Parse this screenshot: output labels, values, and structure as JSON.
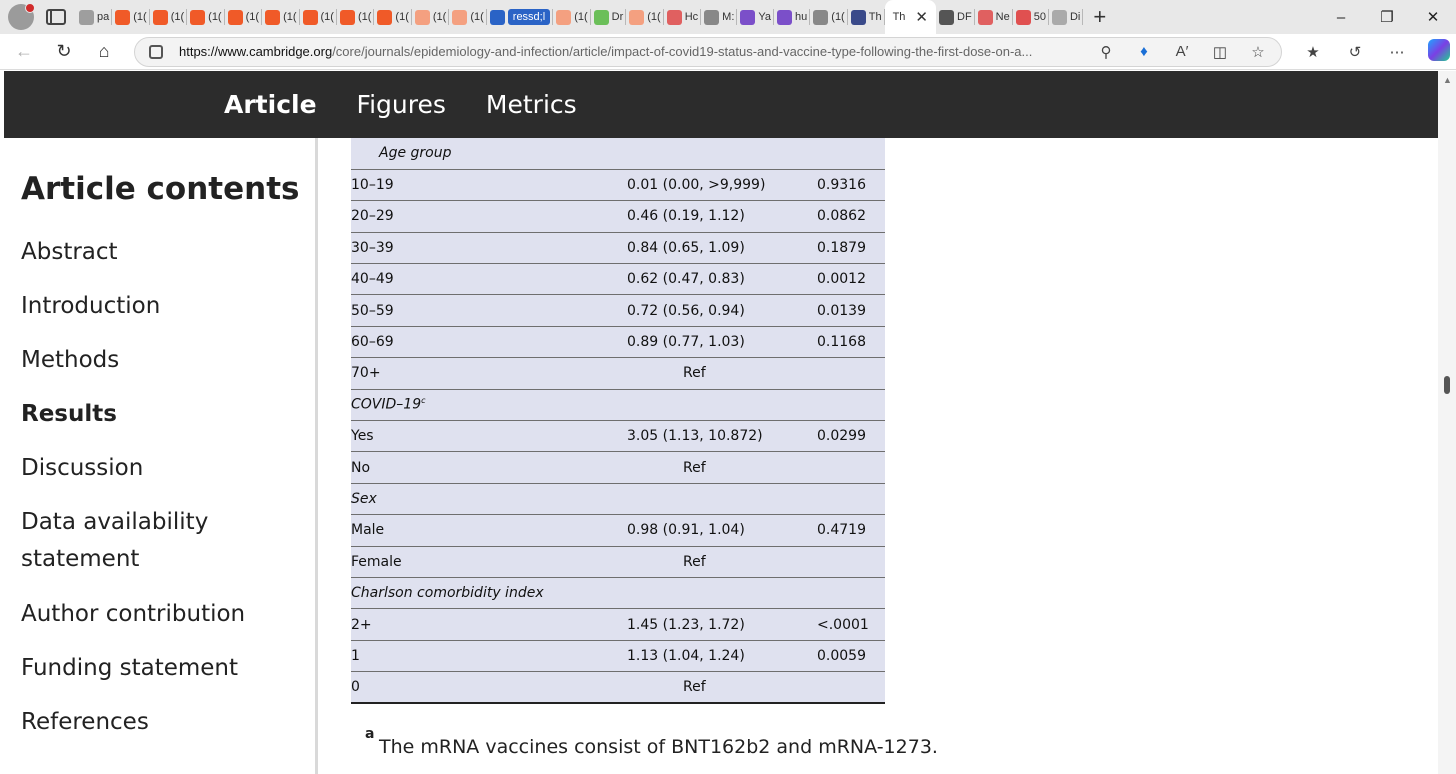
{
  "browser": {
    "tabs": [
      {
        "label": "pa",
        "color": "#9e9e9e"
      },
      {
        "label": "(1(",
        "color": "#f05a28"
      },
      {
        "label": "(1(",
        "color": "#f05a28"
      },
      {
        "label": "(1(",
        "color": "#f05a28"
      },
      {
        "label": "(1(",
        "color": "#f05a28"
      },
      {
        "label": "(1(",
        "color": "#f05a28"
      },
      {
        "label": "(1(",
        "color": "#f05a28"
      },
      {
        "label": "(1(",
        "color": "#f05a28"
      },
      {
        "label": "(1(",
        "color": "#f05a28"
      },
      {
        "label": "(1(",
        "color": "#f4a080"
      },
      {
        "label": "(1(",
        "color": "#f4a080"
      },
      {
        "label": "ressd;l",
        "color": "#2a63c6",
        "pill": true
      },
      {
        "label": "(1(",
        "color": "#f4a080"
      },
      {
        "label": "Dr",
        "color": "#6bbf59"
      },
      {
        "label": "(1(",
        "color": "#f4a080"
      },
      {
        "label": "Hc",
        "color": "#e06060"
      },
      {
        "label": "M:",
        "color": "#888888"
      },
      {
        "label": "Ya",
        "color": "#7b4fc9"
      },
      {
        "label": "hu",
        "color": "#7b4fc9"
      },
      {
        "label": "(1(",
        "color": "#888888"
      },
      {
        "label": "Th",
        "color": "#3a4a8a"
      }
    ],
    "active_tab": "Th",
    "tabs_after": [
      {
        "label": "DF",
        "color": "#555555"
      },
      {
        "label": "Ne",
        "color": "#e06060"
      },
      {
        "label": "50",
        "color": "#e05050"
      },
      {
        "label": "Di",
        "color": "#aaaaaa"
      }
    ],
    "url_host": "https://www.cambridge.org",
    "url_rest": "/core/journals/epidemiology-and-infection/article/impact-of-covid19-status-and-vaccine-type-following-the-first-dose-on-a..."
  },
  "site_nav": {
    "items": [
      "Article",
      "Figures",
      "Metrics"
    ]
  },
  "sidebar": {
    "title": "Article contents",
    "items": [
      {
        "label": "Abstract",
        "bold": false
      },
      {
        "label": "Introduction",
        "bold": false
      },
      {
        "label": "Methods",
        "bold": false
      },
      {
        "label": "Results",
        "bold": true
      },
      {
        "label": "Discussion",
        "bold": false
      },
      {
        "label": "Data availability statement",
        "bold": false
      },
      {
        "label": "Author contribution",
        "bold": false
      },
      {
        "label": "Funding statement",
        "bold": false
      },
      {
        "label": "References",
        "bold": false
      }
    ]
  },
  "table": {
    "rows": [
      {
        "kind": "cat",
        "label": "Age group",
        "indent": true
      },
      {
        "kind": "row",
        "label": "10–19",
        "or": "0.01 (0.00, >9,999)",
        "p": "0.9316",
        "lvl": 1
      },
      {
        "kind": "row",
        "label": "20–29",
        "or": "0.46 (0.19, 1.12)",
        "p": "0.0862",
        "lvl": 1
      },
      {
        "kind": "row",
        "label": "30–39",
        "or": "0.84 (0.65, 1.09)",
        "p": "0.1879",
        "lvl": 1
      },
      {
        "kind": "row",
        "label": "40–49",
        "or": "0.62 (0.47, 0.83)",
        "p": "0.0012",
        "lvl": 1
      },
      {
        "kind": "row",
        "label": "50–59",
        "or": "0.72 (0.56, 0.94)",
        "p": "0.0139",
        "lvl": 1
      },
      {
        "kind": "row",
        "label": "60–69",
        "or": "0.89 (0.77, 1.03)",
        "p": "0.1168",
        "lvl": 1
      },
      {
        "kind": "ref",
        "label": "70+",
        "or": "Ref",
        "lvl": 1
      },
      {
        "kind": "cat",
        "label": "COVID–19",
        "sup": "c",
        "indent": false
      },
      {
        "kind": "row",
        "label": "Yes",
        "or": "3.05 (1.13, 10.872)",
        "p": "0.0299",
        "lvl": 0
      },
      {
        "kind": "ref",
        "label": "No",
        "or": "Ref",
        "lvl": 0
      },
      {
        "kind": "cat",
        "label": "Sex",
        "indent": false
      },
      {
        "kind": "row",
        "label": "Male",
        "or": "0.98 (0.91, 1.04)",
        "p": "0.4719",
        "lvl": 0
      },
      {
        "kind": "ref",
        "label": "Female",
        "or": "Ref",
        "lvl": 0
      },
      {
        "kind": "cat",
        "label": "Charlson comorbidity index",
        "indent": false
      },
      {
        "kind": "row",
        "label": "2+",
        "or": "1.45 (1.23, 1.72)",
        "p": "<.0001",
        "lvl": 0
      },
      {
        "kind": "row",
        "label": "1",
        "or": "1.13 (1.04, 1.24)",
        "p": "0.0059",
        "lvl": 0
      },
      {
        "kind": "ref",
        "label": "0",
        "or": "Ref",
        "lvl": 0
      }
    ]
  },
  "footnote": {
    "mark": "a",
    "text": "The mRNA vaccines consist of BNT162b2 and mRNA-1273."
  }
}
